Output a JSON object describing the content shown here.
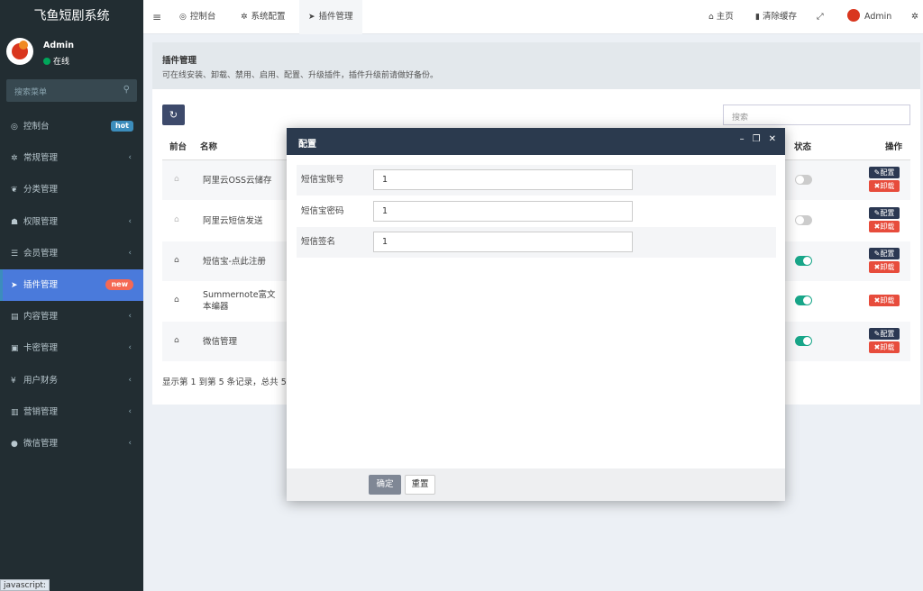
{
  "sidebar": {
    "brand": "飞鱼短剧系统",
    "user": {
      "name": "Admin",
      "status": "在线"
    },
    "search_placeholder": "搜索菜单",
    "items": [
      {
        "label": "控制台",
        "icon": "dashboard-icon",
        "glyph": "◎",
        "badge": "hot"
      },
      {
        "label": "常规管理",
        "icon": "cogs-icon",
        "glyph": "✲",
        "chevron": "‹"
      },
      {
        "label": "分类管理",
        "icon": "leaf-icon",
        "glyph": "❦"
      },
      {
        "label": "权限管理",
        "icon": "users-icon",
        "glyph": "☗",
        "chevron": "‹"
      },
      {
        "label": "会员管理",
        "icon": "list-icon",
        "glyph": "☰",
        "chevron": "‹"
      },
      {
        "label": "插件管理",
        "icon": "rocket-icon",
        "glyph": "➤",
        "badge": "new",
        "active": true
      },
      {
        "label": "内容管理",
        "icon": "file-icon",
        "glyph": "▤",
        "chevron": "‹"
      },
      {
        "label": "卡密管理",
        "icon": "image-icon",
        "glyph": "▣",
        "chevron": "‹"
      },
      {
        "label": "用户财务",
        "icon": "yen-icon",
        "glyph": "¥",
        "chevron": "‹"
      },
      {
        "label": "营销管理",
        "icon": "bar-chart-icon",
        "glyph": "▥",
        "chevron": "‹"
      },
      {
        "label": "微信管理",
        "icon": "wechat-icon",
        "glyph": "●",
        "chevron": "‹"
      }
    ],
    "statusbar": "javascript:"
  },
  "topbar": {
    "tabs": [
      {
        "label": "控制台",
        "glyph": "◎"
      },
      {
        "label": "系统配置",
        "glyph": "✲"
      },
      {
        "label": "插件管理",
        "glyph": "➤"
      }
    ],
    "home": "主页",
    "clear_cache": "清除缓存",
    "admin": "Admin"
  },
  "content": {
    "title": "插件管理",
    "description": "可在线安装、卸载、禁用、启用、配置、升级插件，插件升级前请做好备份。",
    "search_placeholder": "搜索",
    "columns": {
      "frontend": "前台",
      "name": "名称",
      "status": "状态",
      "actions": "操作"
    },
    "rows": [
      {
        "name": "阿里云OSS云储存",
        "home_on": false,
        "status_on": false,
        "has_config": true
      },
      {
        "name": "阿里云短信发送",
        "home_on": false,
        "status_on": false,
        "has_config": true
      },
      {
        "name": "短信宝-点此注册",
        "home_on": true,
        "status_on": true,
        "has_config": true
      },
      {
        "name": "Summernote富文本编器",
        "home_on": true,
        "status_on": true,
        "has_config": false
      },
      {
        "name": "微信管理",
        "home_on": true,
        "status_on": true,
        "has_config": true
      }
    ],
    "config_label": "配置",
    "uninstall_label": "卸载",
    "pager": "显示第 1 到第 5 条记录，总共 5"
  },
  "modal": {
    "title": "配置",
    "fields": [
      {
        "label": "短信宝账号",
        "value": "1"
      },
      {
        "label": "短信宝密码",
        "value": "1"
      },
      {
        "label": "短信签名",
        "value": "1"
      }
    ],
    "ok": "确定",
    "reset": "重置"
  }
}
